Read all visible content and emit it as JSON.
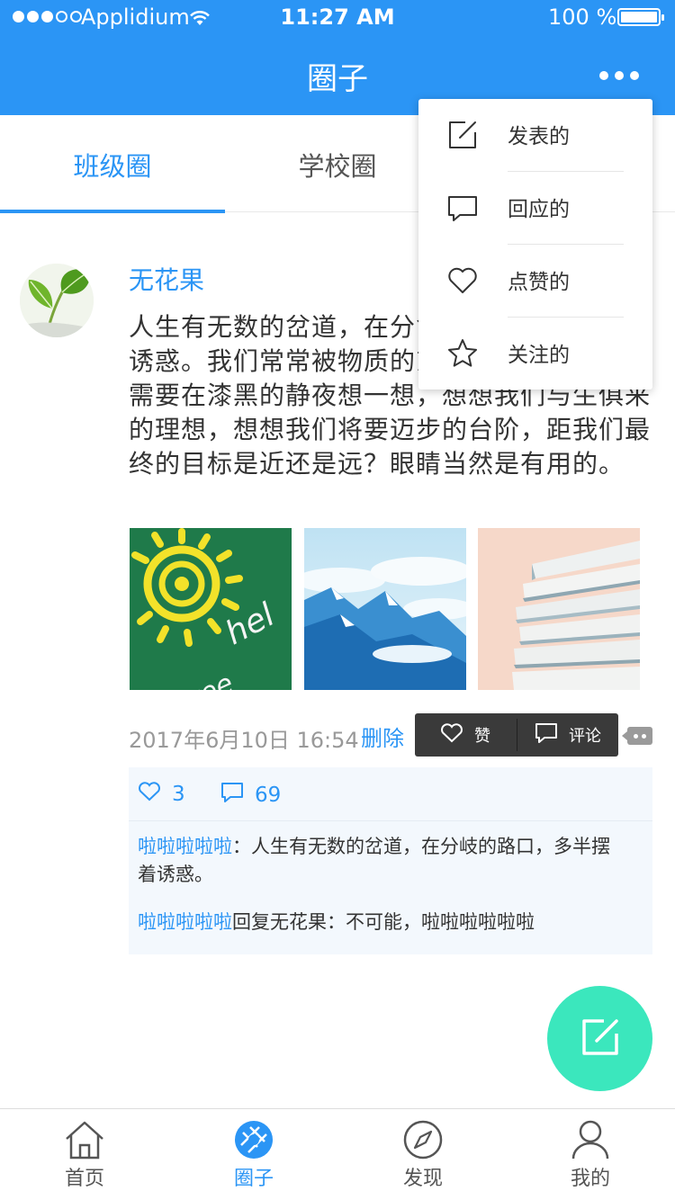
{
  "status_bar": {
    "carrier": "Applidium",
    "time": "11:27 AM",
    "battery": "100 %"
  },
  "nav": {
    "title": "圈子"
  },
  "tabs": [
    {
      "label": "班级圈",
      "active": true
    },
    {
      "label": "学校圈",
      "active": false
    }
  ],
  "menu": {
    "items": [
      {
        "label": "发表的",
        "icon": "edit-icon"
      },
      {
        "label": "回应的",
        "icon": "comment-icon"
      },
      {
        "label": "点赞的",
        "icon": "heart-icon"
      },
      {
        "label": "关注的",
        "icon": "star-icon"
      }
    ]
  },
  "post": {
    "author": "无花果",
    "text": "人生有无数的岔道，在分岔的路口，多半摆着诱惑。我们常常被物质的东西迷住了双眼睛。需要在漆黑的静夜想一想，想想我们与生俱来的理想，想想我们将要迈步的台阶，距我们最终的目标是近还是远？眼睛当然是有用的。",
    "images": [
      "hello-chalkboard-sun",
      "mountains-clouds",
      "book-stack"
    ],
    "time": "2017年6月10日 16:54",
    "delete_label": "删除",
    "like_action": "赞",
    "comment_action": "评论",
    "likes": "3",
    "comments_count": "69",
    "replies": [
      {
        "user": "啦啦啦啦啦",
        "sep": "：",
        "text": "人生有无数的岔道，在分岐的路口，多半摆着诱惑。"
      },
      {
        "user": "啦啦啦啦啦",
        "sep": "回复无花果：",
        "text": "不可能，啦啦啦啦啦啦"
      }
    ]
  },
  "tabbar": [
    {
      "label": "首页",
      "active": false
    },
    {
      "label": "圈子",
      "active": true
    },
    {
      "label": "发现",
      "active": false
    },
    {
      "label": "我的",
      "active": false
    }
  ],
  "colors": {
    "primary": "#2b95f5",
    "fab": "#3be7bd"
  }
}
